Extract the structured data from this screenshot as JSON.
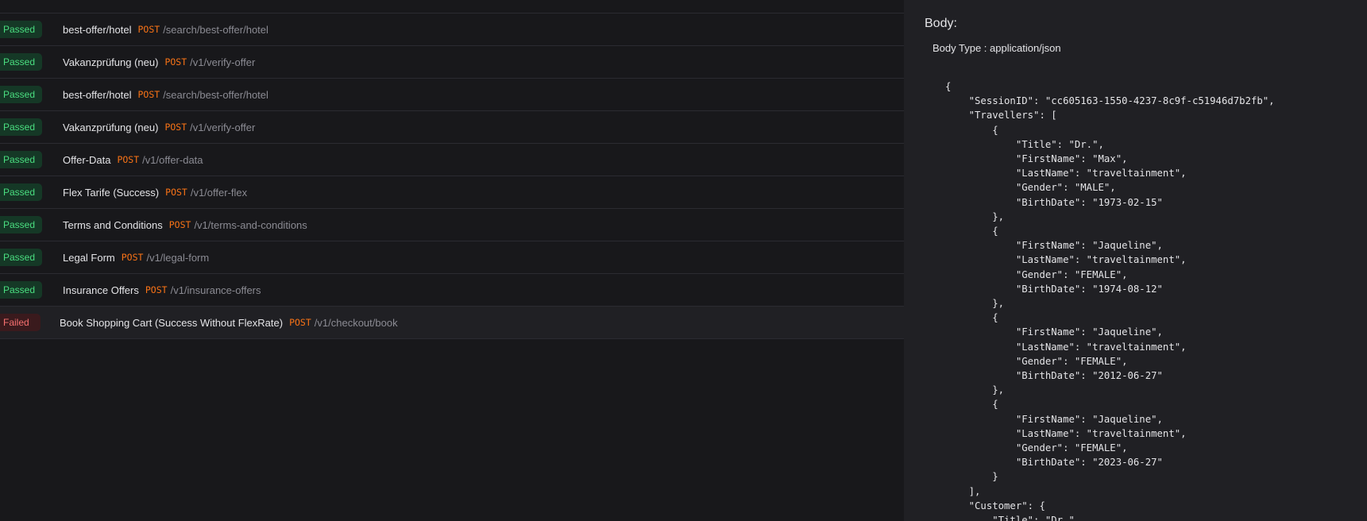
{
  "requests": [
    {
      "status": "Passed",
      "name": "best-offer/hotel",
      "method": "POST",
      "path": "/search/best-offer/hotel"
    },
    {
      "status": "Passed",
      "name": "Vakanzprüfung (neu)",
      "method": "POST",
      "path": "/v1/verify-offer"
    },
    {
      "status": "Passed",
      "name": "best-offer/hotel",
      "method": "POST",
      "path": "/search/best-offer/hotel"
    },
    {
      "status": "Passed",
      "name": "Vakanzprüfung (neu)",
      "method": "POST",
      "path": "/v1/verify-offer"
    },
    {
      "status": "Passed",
      "name": "Offer-Data",
      "method": "POST",
      "path": "/v1/offer-data"
    },
    {
      "status": "Passed",
      "name": "Flex Tarife (Success)",
      "method": "POST",
      "path": "/v1/offer-flex"
    },
    {
      "status": "Passed",
      "name": "Terms and Conditions",
      "method": "POST",
      "path": "/v1/terms-and-conditions"
    },
    {
      "status": "Passed",
      "name": "Legal Form",
      "method": "POST",
      "path": "/v1/legal-form"
    },
    {
      "status": "Passed",
      "name": "Insurance Offers",
      "method": "POST",
      "path": "/v1/insurance-offers"
    },
    {
      "status": "Failed",
      "name": "Book Shopping Cart (Success Without FlexRate)",
      "method": "POST",
      "path": "/v1/checkout/book"
    }
  ],
  "body_panel": {
    "title": "Body:",
    "body_type": "Body Type : application/json",
    "code": "{\n    \"SessionID\": \"cc605163-1550-4237-8c9f-c51946d7b2fb\",\n    \"Travellers\": [\n        {\n            \"Title\": \"Dr.\",\n            \"FirstName\": \"Max\",\n            \"LastName\": \"traveltainment\",\n            \"Gender\": \"MALE\",\n            \"BirthDate\": \"1973-02-15\"\n        },\n        {\n            \"FirstName\": \"Jaqueline\",\n            \"LastName\": \"traveltainment\",\n            \"Gender\": \"FEMALE\",\n            \"BirthDate\": \"1974-08-12\"\n        },\n        {\n            \"FirstName\": \"Jaqueline\",\n            \"LastName\": \"traveltainment\",\n            \"Gender\": \"FEMALE\",\n            \"BirthDate\": \"2012-06-27\"\n        },\n        {\n            \"FirstName\": \"Jaqueline\",\n            \"LastName\": \"traveltainment\",\n            \"Gender\": \"FEMALE\",\n            \"BirthDate\": \"2023-06-27\"\n        }\n    ],\n    \"Customer\": {\n        \"Title\": \"Dr.\","
  },
  "colors": {
    "passed": "#4ade80",
    "failed": "#f87171",
    "method": "#f97316"
  }
}
